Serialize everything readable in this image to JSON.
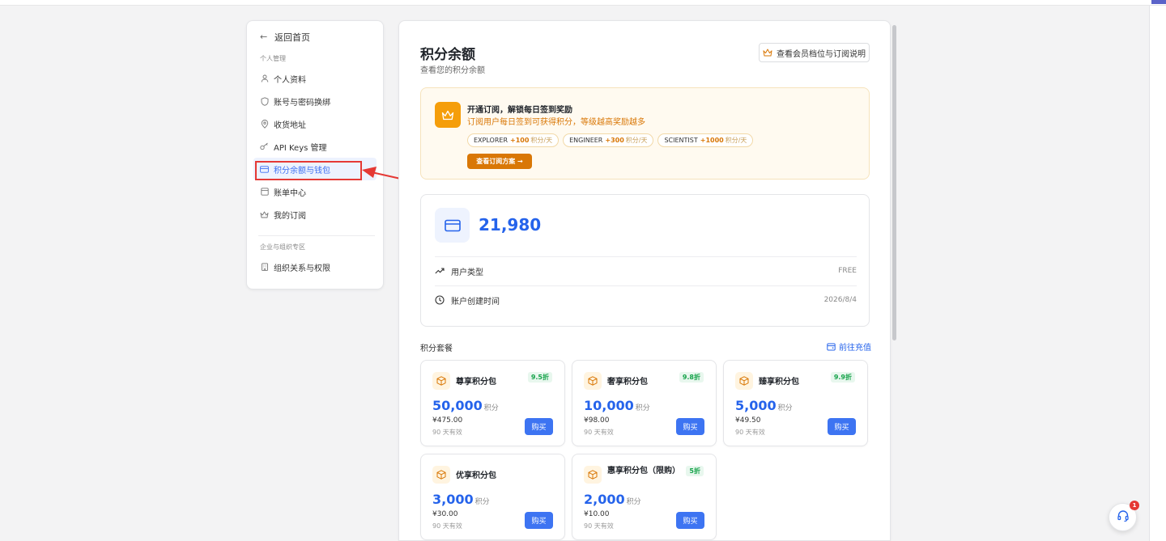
{
  "sidebar": {
    "back_label": "返回首页",
    "section_personal": "个人管理",
    "items": [
      {
        "label": "个人资料",
        "icon": "user-icon"
      },
      {
        "label": "账号与密码换绑",
        "icon": "shield-icon"
      },
      {
        "label": "收货地址",
        "icon": "location-icon"
      },
      {
        "label": "API Keys 管理",
        "icon": "key-icon"
      },
      {
        "label": "积分余额与钱包",
        "icon": "card-icon"
      },
      {
        "label": "账单中心",
        "icon": "bill-icon"
      },
      {
        "label": "我的订阅",
        "icon": "crown-icon"
      }
    ],
    "section_org": "企业与组织专区",
    "org_items": [
      {
        "label": "组织关系与权限",
        "icon": "building-icon"
      }
    ]
  },
  "header": {
    "title": "积分余额",
    "subtitle": "查看您的积分余额",
    "member_button": "查看会员档位与订阅说明"
  },
  "promo": {
    "title": "开通订阅，解锁每日签到奖励",
    "desc": "订阅用户每日签到可获得积分，等级越高奖励越多",
    "tiers": [
      {
        "name": "EXPLORER",
        "value": "+100",
        "unit": "积分/天"
      },
      {
        "name": "ENGINEER",
        "value": "+300",
        "unit": "积分/天"
      },
      {
        "name": "SCIENTIST",
        "value": "+1000",
        "unit": "积分/天"
      }
    ],
    "button": "查看订阅方案 →"
  },
  "balance": {
    "amount": "21,980",
    "user_type_label": "用户类型",
    "user_type_value": "FREE",
    "created_label": "账户创建时间",
    "created_value": "2026/8/4"
  },
  "packages": {
    "heading": "积分套餐",
    "link": "前往充值",
    "items": [
      {
        "name": "尊享积分包",
        "discount": "9.5折",
        "points": "50,000",
        "unit": "积分",
        "price": "¥475.00",
        "valid": "90 天有效",
        "buy": "购买"
      },
      {
        "name": "奢享积分包",
        "discount": "9.8折",
        "points": "10,000",
        "unit": "积分",
        "price": "¥98.00",
        "valid": "90 天有效",
        "buy": "购买"
      },
      {
        "name": "臻享积分包",
        "discount": "9.9折",
        "points": "5,000",
        "unit": "积分",
        "price": "¥49.50",
        "valid": "90 天有效",
        "buy": "购买"
      },
      {
        "name": "优享积分包",
        "discount": "",
        "points": "3,000",
        "unit": "积分",
        "price": "¥30.00",
        "valid": "90 天有效",
        "buy": "购买"
      },
      {
        "name": "惠享积分包（限购）",
        "discount": "5折",
        "points": "2,000",
        "unit": "积分",
        "price": "¥10.00",
        "valid": "90 天有效",
        "buy": "购买"
      }
    ]
  },
  "support": {
    "badge": "1",
    "icon": "headset-icon"
  },
  "colors": {
    "accent": "#2563eb",
    "orange": "#d97706",
    "highlight": "#e53935"
  }
}
